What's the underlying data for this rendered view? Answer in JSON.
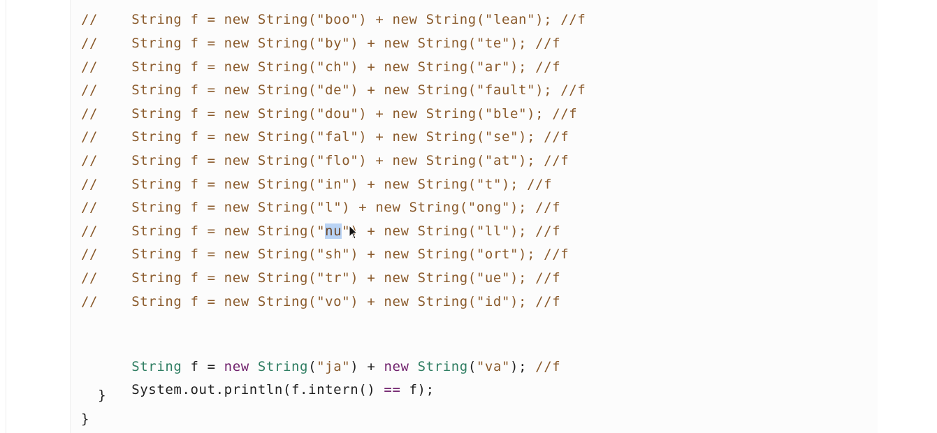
{
  "editor": {
    "commented_lines": [
      {
        "prefix": "//    String f = new String(\"",
        "left": "boo",
        "mid": "\") + new String(\"",
        "right": "lean",
        "suffix": "\"); //f"
      },
      {
        "prefix": "//    String f = new String(\"",
        "left": "by",
        "mid": "\") + new String(\"",
        "right": "te",
        "suffix": "\"); //f"
      },
      {
        "prefix": "//    String f = new String(\"",
        "left": "ch",
        "mid": "\") + new String(\"",
        "right": "ar",
        "suffix": "\"); //f"
      },
      {
        "prefix": "//    String f = new String(\"",
        "left": "de",
        "mid": "\") + new String(\"",
        "right": "fault",
        "suffix": "\"); //f"
      },
      {
        "prefix": "//    String f = new String(\"",
        "left": "dou",
        "mid": "\") + new String(\"",
        "right": "ble",
        "suffix": "\"); //f"
      },
      {
        "prefix": "//    String f = new String(\"",
        "left": "fal",
        "mid": "\") + new String(\"",
        "right": "se",
        "suffix": "\"); //f"
      },
      {
        "prefix": "//    String f = new String(\"",
        "left": "flo",
        "mid": "\") + new String(\"",
        "right": "at",
        "suffix": "\"); //f"
      },
      {
        "prefix": "//    String f = new String(\"",
        "left": "in",
        "mid": "\") + new String(\"",
        "right": "t",
        "suffix": "\"); //f"
      },
      {
        "prefix": "//    String f = new String(\"",
        "left": "l",
        "mid": "\") + new String(\"",
        "right": "ong",
        "suffix": "\"); //f"
      },
      {
        "prefix": "//    String f = new String(\"",
        "left": "nu",
        "mid": "\") + new String(\"",
        "right": "ll",
        "suffix": "\"); //f"
      },
      {
        "prefix": "//    String f = new String(\"",
        "left": "sh",
        "mid": "\") + new String(\"",
        "right": "ort",
        "suffix": "\"); //f"
      },
      {
        "prefix": "//    String f = new String(\"",
        "left": "tr",
        "mid": "\") + new String(\"",
        "right": "ue",
        "suffix": "\"); //f"
      },
      {
        "prefix": "//    String f = new String(\"",
        "left": "vo",
        "mid": "\") + new String(\"",
        "right": "id",
        "suffix": "\"); //f"
      }
    ],
    "selected_line_index": 9,
    "active_line": {
      "indent": "    ",
      "type1": "String",
      "var": " f = ",
      "kw_new1": "new",
      "type2": "String",
      "open1": "(",
      "str1": "\"ja\"",
      "plus": ") + ",
      "kw_new2": "new",
      "type3": "String",
      "open2": "(",
      "str2": "\"va\"",
      "close": "); ",
      "comment": "//f"
    },
    "println_line": {
      "indent": "    ",
      "text_a": "System.out.println(f.intern() ",
      "op": "==",
      "text_b": " f);"
    },
    "close_brace_inner": "  }",
    "close_brace_outer": "}"
  }
}
